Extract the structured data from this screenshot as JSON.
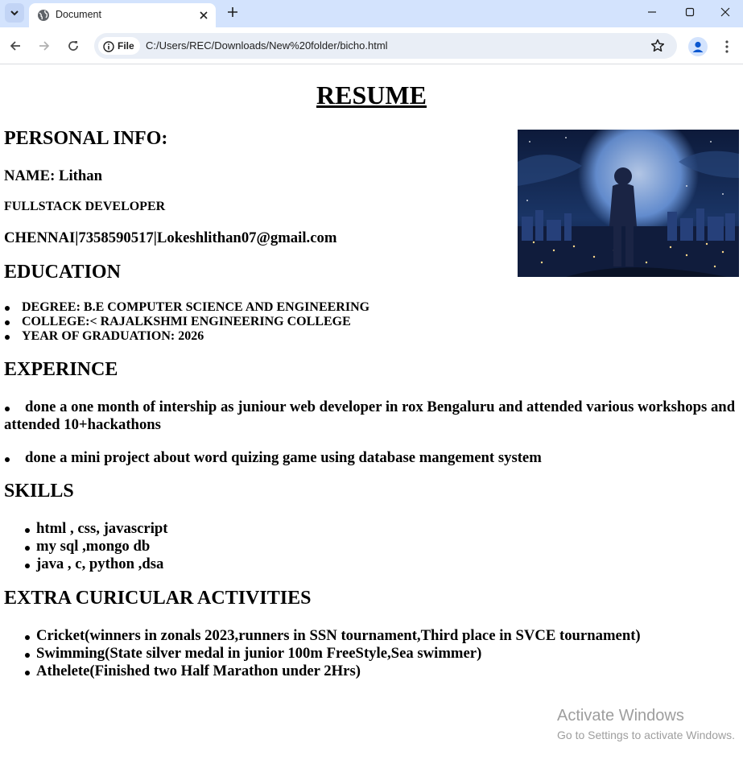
{
  "browser": {
    "tab_title": "Document",
    "address_chip": "File",
    "url": "C:/Users/REC/Downloads/New%20folder/bicho.html",
    "icons": [
      "tab-search-icon",
      "globe-icon",
      "close-icon",
      "plus-icon",
      "minimize-icon",
      "maximize-icon",
      "window-close-icon",
      "back-arrow-icon",
      "forward-arrow-icon",
      "reload-icon",
      "info-icon",
      "star-icon",
      "profile-icon",
      "kebab-menu-icon"
    ],
    "accent_color": "#d3e3fd"
  },
  "resume": {
    "title": "RESUME",
    "personal": {
      "heading": "PERSONAL INFO:",
      "name": "NAME: Lithan",
      "role": "FULLSTACK DEVELOPER",
      "contact": "CHENNAI|7358590517|Lokeshlithan07@gmail.com"
    },
    "education": {
      "heading": "EDUCATION",
      "items": [
        "DEGREE: B.E COMPUTER SCIENCE AND ENGINEERING",
        "COLLEGE:< RAJALKSHMI ENGINEERING COLLEGE",
        "YEAR OF GRADUATION: 2026"
      ]
    },
    "experience": {
      "heading": "EXPERINCE",
      "item1_line1": "done a one month of intership as juniour web developer in rox Bengaluru and attended various workshops and",
      "item1_line2": "attended 10+hackathons",
      "item2": "done a mini project about word quizing game using database mangement system"
    },
    "skills": {
      "heading": "SKILLS",
      "items": [
        "html , css, javascript",
        "my sql ,mongo db",
        "java , c, python ,dsa"
      ]
    },
    "activities": {
      "heading": "EXTRA CURICULAR ACTIVITIES",
      "items": [
        "Cricket(winners in zonals 2023,runners in SSN tournament,Third place in SVCE tournament)",
        "Swimming(State silver medal in junior 100m FreeStyle,Sea swimmer)",
        "Athelete(Finished two Half Marathon under 2Hrs)"
      ]
    }
  },
  "watermark": {
    "line1": "Activate Windows",
    "line2": "Go to Settings to activate Windows."
  }
}
